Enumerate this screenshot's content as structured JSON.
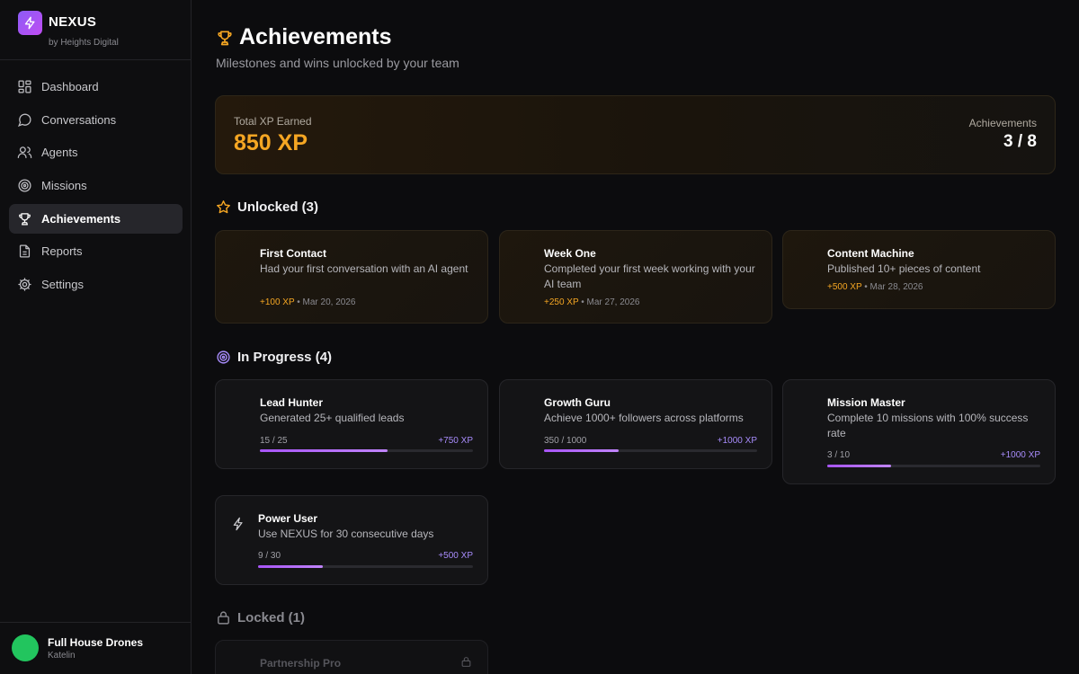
{
  "brand": {
    "name": "NEXUS",
    "sub": "by Heights Digital"
  },
  "nav": [
    {
      "label": "Dashboard",
      "icon": "dashboard-icon",
      "active": false
    },
    {
      "label": "Conversations",
      "icon": "chat-icon",
      "active": false
    },
    {
      "label": "Agents",
      "icon": "users-icon",
      "active": false
    },
    {
      "label": "Missions",
      "icon": "target-icon",
      "active": false
    },
    {
      "label": "Achievements",
      "icon": "trophy-icon",
      "active": true
    },
    {
      "label": "Reports",
      "icon": "document-icon",
      "active": false
    },
    {
      "label": "Settings",
      "icon": "gear-icon",
      "active": false
    }
  ],
  "user": {
    "name": "Full House Drones",
    "sub": "Katelin",
    "avatar_color": "#22c55e"
  },
  "page": {
    "title": "Achievements",
    "subtitle": "Milestones and wins unlocked by your team"
  },
  "summary": {
    "xp_label": "Total XP Earned",
    "xp_value": "850 XP",
    "ach_label": "Achievements",
    "ach_value": "3 / 8"
  },
  "sections": {
    "unlocked": "Unlocked (3)",
    "in_progress": "In Progress (4)",
    "locked": "Locked (1)"
  },
  "unlocked": [
    {
      "title": "First Contact",
      "desc": "Had your first conversation with an AI agent",
      "xp": "+100 XP",
      "date": "• Mar 20, 2026"
    },
    {
      "title": "Week One",
      "desc": "Completed your first week working with your AI team",
      "xp": "+250 XP",
      "date": "• Mar 27, 2026"
    },
    {
      "title": "Content Machine",
      "desc": "Published 10+ pieces of content",
      "xp": "+500 XP",
      "date": "• Mar 28, 2026"
    }
  ],
  "in_progress": [
    {
      "title": "Lead Hunter",
      "desc": "Generated 25+ qualified leads",
      "count": "15 / 25",
      "reward": "+750 XP",
      "progress": 0.6
    },
    {
      "title": "Growth Guru",
      "desc": "Achieve 1000+ followers across platforms",
      "count": "350 / 1000",
      "reward": "+1000 XP",
      "progress": 0.35
    },
    {
      "title": "Mission Master",
      "desc": "Complete 10 missions with 100% success rate",
      "count": "3 / 10",
      "reward": "+1000 XP",
      "progress": 0.3
    },
    {
      "title": "Power User",
      "desc": "Use NEXUS for 30 consecutive days",
      "count": "9 / 30",
      "reward": "+500 XP",
      "progress": 0.3
    }
  ],
  "locked": [
    {
      "title": "Partnership Pro"
    }
  ],
  "colors": {
    "accent": "#8b5cf6",
    "xp": "#f5a623",
    "progress": "#a855f7"
  }
}
